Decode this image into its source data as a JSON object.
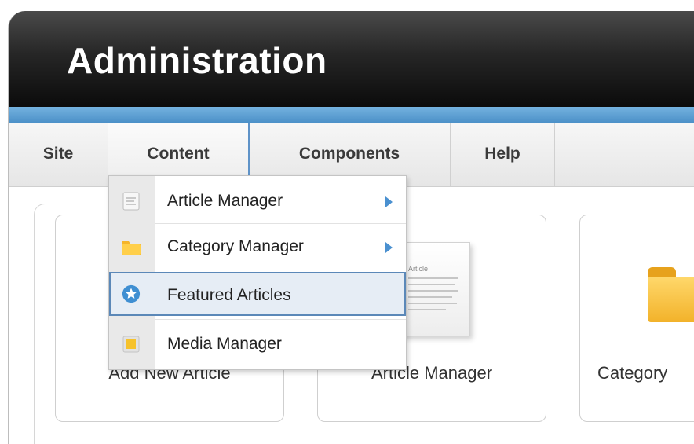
{
  "header": {
    "title": "Administration"
  },
  "menubar": {
    "items": [
      {
        "label": "Site"
      },
      {
        "label": "Content"
      },
      {
        "label": "Components"
      },
      {
        "label": "Help"
      }
    ]
  },
  "dropdown": {
    "items": [
      {
        "label": "Article Manager",
        "icon": "article-icon",
        "submenu": true
      },
      {
        "label": "Category Manager",
        "icon": "folder-icon",
        "submenu": true
      },
      {
        "label": "Featured Articles",
        "icon": "star-icon",
        "submenu": false,
        "highlighted": true
      },
      {
        "label": "Media Manager",
        "icon": "media-icon",
        "submenu": false
      }
    ]
  },
  "cpanel": {
    "tiles": [
      {
        "label": "Add New Article"
      },
      {
        "label": "Article Manager",
        "icon": "article-document-icon",
        "doc_heading": "Article"
      },
      {
        "label": "Category",
        "icon": "folder-icon"
      }
    ]
  },
  "colors": {
    "header_bg": "#0b0b0b",
    "accent_blue": "#4a8fc7",
    "menu_text": "#3a3a3a",
    "highlight_border": "#5b88b8"
  }
}
